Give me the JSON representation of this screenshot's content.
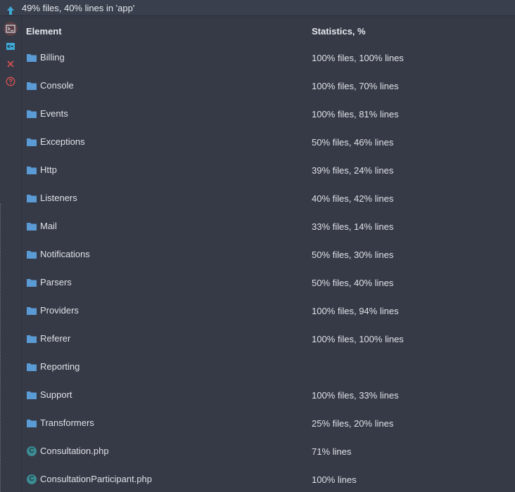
{
  "header": {
    "summary": "49% files, 40% lines in 'app'"
  },
  "toolbar": {
    "buttons": [
      {
        "name": "arrow-up-icon",
        "color": "#3fa9d6"
      },
      {
        "name": "export-coverage-icon",
        "color": "#c9cdd4"
      },
      {
        "name": "import-coverage-icon",
        "color": "#3fa9d6"
      },
      {
        "name": "close-icon",
        "color": "#d9534f"
      },
      {
        "name": "help-icon",
        "color": "#d9534f"
      }
    ]
  },
  "table": {
    "columns": [
      "Element",
      "Statistics, %"
    ],
    "rows": [
      {
        "type": "folder",
        "name": "Billing",
        "stats": "100% files, 100% lines"
      },
      {
        "type": "folder",
        "name": "Console",
        "stats": "100% files, 70% lines"
      },
      {
        "type": "folder",
        "name": "Events",
        "stats": "100% files, 81% lines"
      },
      {
        "type": "folder",
        "name": "Exceptions",
        "stats": "50% files, 46% lines"
      },
      {
        "type": "folder",
        "name": "Http",
        "stats": "39% files, 24% lines"
      },
      {
        "type": "folder",
        "name": "Listeners",
        "stats": "40% files, 42% lines"
      },
      {
        "type": "folder",
        "name": "Mail",
        "stats": "33% files, 14% lines"
      },
      {
        "type": "folder",
        "name": "Notifications",
        "stats": "50% files, 30% lines"
      },
      {
        "type": "folder",
        "name": "Parsers",
        "stats": "50% files, 40% lines"
      },
      {
        "type": "folder",
        "name": "Providers",
        "stats": "100% files, 94% lines"
      },
      {
        "type": "folder",
        "name": "Referer",
        "stats": "100% files, 100% lines"
      },
      {
        "type": "folder",
        "name": "Reporting",
        "stats": ""
      },
      {
        "type": "folder",
        "name": "Support",
        "stats": "100% files, 33% lines"
      },
      {
        "type": "folder",
        "name": "Transformers",
        "stats": "25% files, 20% lines"
      },
      {
        "type": "class",
        "name": "Consultation.php",
        "stats": "71% lines",
        "icon_letter": "C"
      },
      {
        "type": "class",
        "name": "ConsultationParticipant.php",
        "stats": "100% lines",
        "icon_letter": "C"
      }
    ]
  },
  "colors": {
    "background": "#363a47",
    "folder": "#5b9bd5",
    "class_icon": "#3c8c94"
  }
}
